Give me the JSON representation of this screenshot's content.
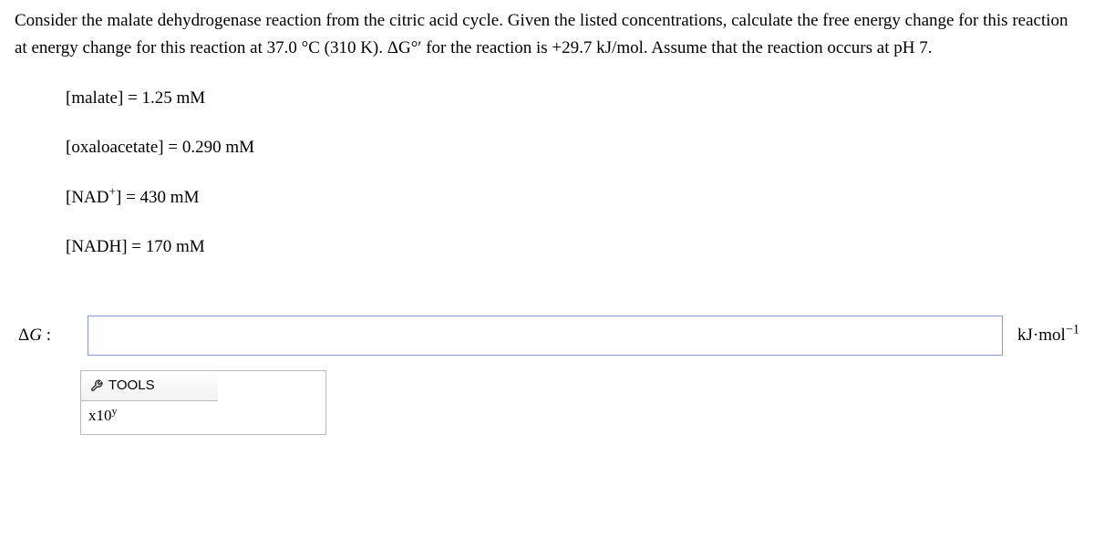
{
  "problem": {
    "statement": "Consider the malate dehydrogenase reaction from the citric acid cycle. Given the listed concentrations, calculate the free energy change for this reaction at energy change for this reaction at 37.0 °C (310 K). ΔG°′ for the reaction is +29.7 kJ/mol. Assume that the reaction occurs at pH 7.",
    "concentrations": [
      {
        "species": "[malate]",
        "value": "1.25 mM"
      },
      {
        "species_html": "[oxaloacetate]",
        "value": "0.290 mM"
      },
      {
        "species_nad": "[NAD",
        "sup": "+",
        "close": "]",
        "value": "430 mM"
      },
      {
        "species": "[NADH]",
        "value": "170 mM"
      }
    ]
  },
  "answer": {
    "label_prefix": "Δ",
    "label_var": "G",
    "label_suffix": " :",
    "value": "",
    "unit_prefix": "kJ·mol",
    "unit_exp": "−1"
  },
  "tools": {
    "header": "TOOLS",
    "sci_btn_base": "x10",
    "sci_btn_exp": "y"
  }
}
